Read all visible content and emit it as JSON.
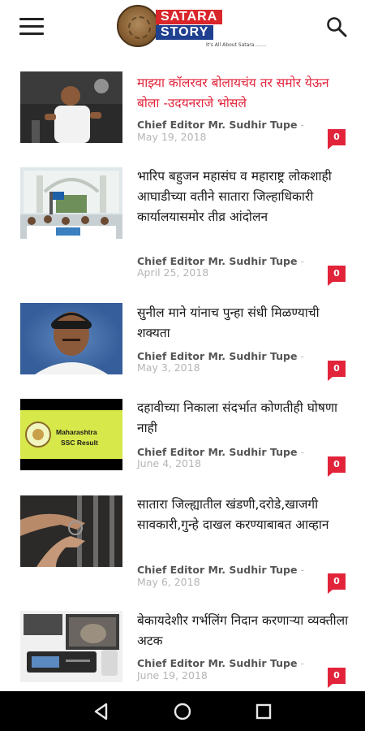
{
  "header": {
    "logo": {
      "word1": "SATARA",
      "word2": "STORY",
      "tagline": "It's All About Satara........"
    }
  },
  "articles": [
    {
      "title": "माझ्या कॉलरवर बोलायचंय तर समोर येऊन बोला -उदयनराजे भोसले",
      "author": "Chief Editor Mr. Sudhir Tupe",
      "date": "May 19, 2018",
      "comments": "0"
    },
    {
      "title": "भारिप बहुजन महासंघ व महाराष्ट्र लोकशाही आघाडीच्या वतीने सातारा जिल्हाधिकारी कार्यालयासमोर तीव्र आंदोलन",
      "author": "Chief Editor Mr. Sudhir Tupe",
      "date": "April 25, 2018",
      "comments": "0"
    },
    {
      "title": "सुनील माने यांनाच पुन्हा संधी मिळण्याची शक्यता",
      "author": "Chief Editor Mr. Sudhir Tupe",
      "date": "May 3, 2018",
      "comments": "0"
    },
    {
      "title": "दहावीच्या निकाला संदर्भात कोणतीही घोषणा नाही",
      "author": "Chief Editor Mr. Sudhir Tupe",
      "date": "June 4, 2018",
      "comments": "0",
      "thumb_text1": "Maharashtra",
      "thumb_text2": "SSC Result"
    },
    {
      "title": "सातारा जिल्ह्यातील खंडणी,दरोडे,खाजगी सावकारी,गुन्हे दाखल करण्याबाबत आव्हान",
      "author": "Chief Editor Mr. Sudhir Tupe",
      "date": "May 6, 2018",
      "comments": "0"
    },
    {
      "title": "बेकायदेशीर गर्भलिंग निदान करणाऱ्या व्यक्तीला अटक",
      "author": "Chief Editor Mr. Sudhir Tupe",
      "date": "June 19, 2018",
      "comments": "0"
    }
  ],
  "colors": {
    "accent": "#e2243b",
    "logo_red": "#d9262b",
    "logo_blue": "#1f3f8f"
  },
  "icons": {
    "menu": "hamburger-icon",
    "search": "search-icon",
    "back": "back-triangle-icon",
    "home": "home-circle-icon",
    "recents": "recents-square-icon"
  }
}
